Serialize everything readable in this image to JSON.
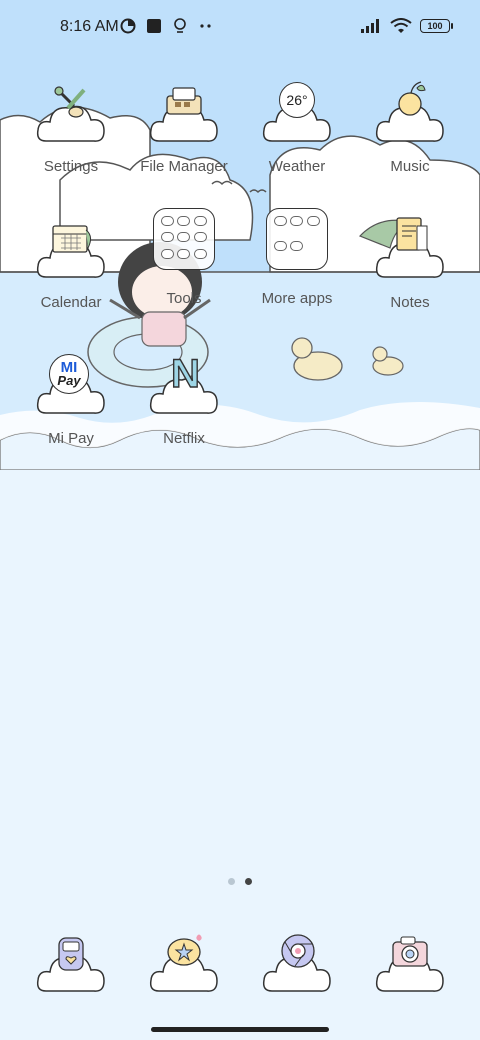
{
  "status_bar": {
    "time": "8:16 AM",
    "battery": "100",
    "left_icons": [
      "data-saver-icon",
      "square-notification-icon",
      "lightbulb-icon",
      "more-dots-icon"
    ],
    "right_icons": [
      "signal-icon",
      "wifi-icon",
      "battery-icon"
    ]
  },
  "apps": {
    "settings": {
      "label": "Settings",
      "icon": "settings-icon"
    },
    "file_manager": {
      "label": "File Manager",
      "icon": "folder-box-icon"
    },
    "weather": {
      "label": "Weather",
      "icon": "weather-icon",
      "temp": "26°"
    },
    "music": {
      "label": "Music",
      "icon": "music-icon"
    },
    "calendar": {
      "label": "Calendar",
      "icon": "calendar-icon"
    },
    "tools": {
      "label": "Tools",
      "icon": "folder-icon"
    },
    "more_apps": {
      "label": "More apps",
      "icon": "folder-icon"
    },
    "notes": {
      "label": "Notes",
      "icon": "notes-icon"
    },
    "mi_pay": {
      "label": "Mi Pay",
      "icon": "mi-pay-icon",
      "logo_top": "MI",
      "logo_bottom": "Pay"
    },
    "netflix": {
      "label": "Netflix",
      "icon": "netflix-icon",
      "logo": "N"
    }
  },
  "dock": [
    {
      "name": "phone",
      "icon": "phone-icon"
    },
    {
      "name": "messages",
      "icon": "message-icon"
    },
    {
      "name": "browser",
      "icon": "chrome-icon"
    },
    {
      "name": "camera",
      "icon": "camera-icon"
    }
  ],
  "pages": {
    "count": 2,
    "active": 2
  },
  "colors": {
    "sky": "#bfe0fb",
    "water": "#eaf5fe",
    "cloud": "#ffffff",
    "outline": "#333333",
    "label": "#555555"
  }
}
